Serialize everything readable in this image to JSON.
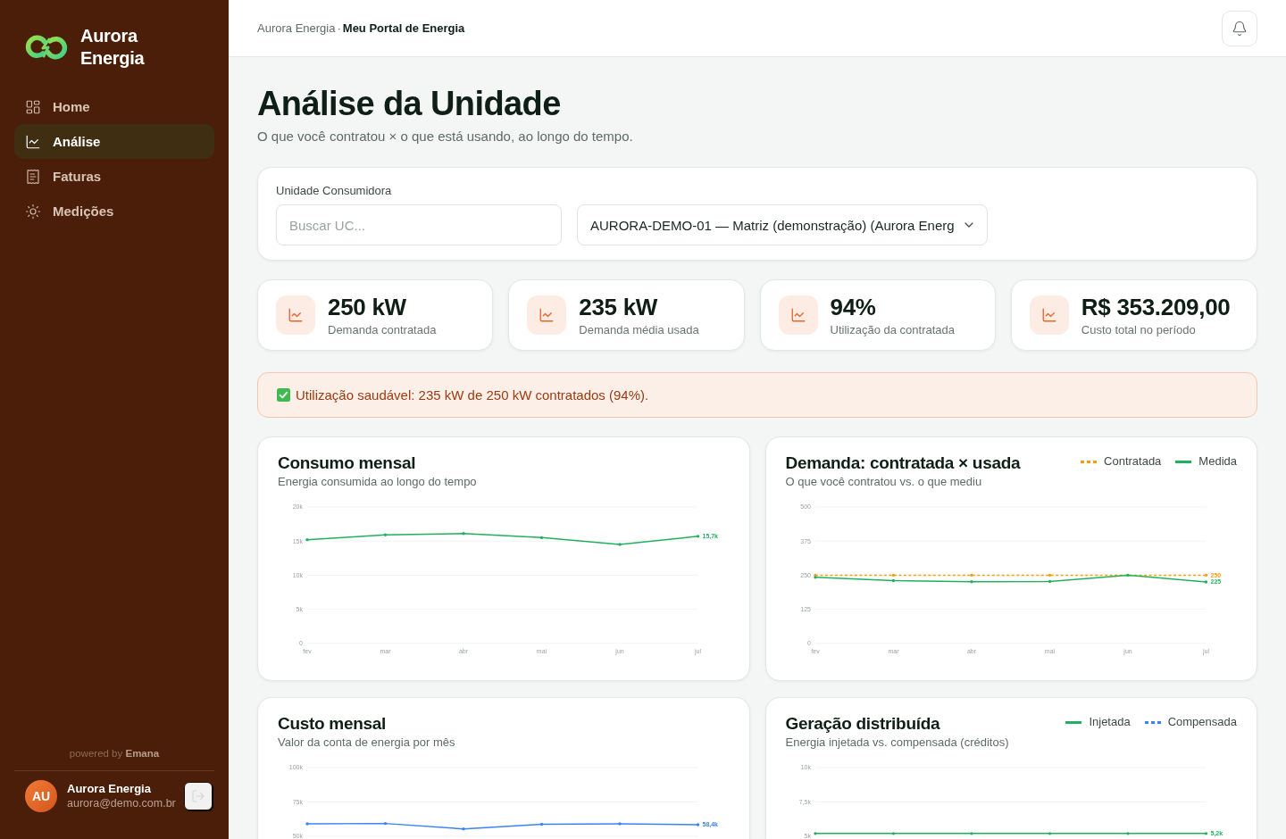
{
  "sidebar": {
    "brand": {
      "name": "Aurora Energia"
    },
    "nav": [
      {
        "label": "Home",
        "selected": false
      },
      {
        "label": "Análise",
        "selected": true
      },
      {
        "label": "Faturas",
        "selected": false
      },
      {
        "label": "Medições",
        "selected": false
      }
    ],
    "powered_by": "powered by **Emana**",
    "user": {
      "initials": "AU",
      "name": "Aurora Energia",
      "email": "aurora@demo.com.br"
    }
  },
  "header": {
    "breadcrumb": {
      "parent": "Aurora Energia",
      "separator": "·",
      "current": "Meu Portal de Energia"
    }
  },
  "page": {
    "title": "Análise da Unidade",
    "subtitle": "O que você contratou × o que está usando, ao longo do tempo."
  },
  "unit_selector": {
    "label": "Unidade Consumidora",
    "search": {
      "placeholder": "Buscar UC..."
    },
    "select": {
      "value": "AURORA-DEMO-01 — Matriz (demonstração) (Aurora Energ"
    }
  },
  "kpis": [
    {
      "value": "250 kW",
      "label": "Demanda contratada"
    },
    {
      "value": "235 kW",
      "label": "Demanda média usada"
    },
    {
      "value": "94%",
      "label": "Utilização da contratada"
    },
    {
      "value": "R$ 353.209,00",
      "label": "Custo total no período"
    }
  ],
  "alert": {
    "kind": "success",
    "text": "Utilização saudável: 235 kW de 250 kW contratados (94%)."
  },
  "charts": [
    {
      "title": "Consumo mensal",
      "subtitle": "Energia consumida ao longo do tempo",
      "chart_data": {
        "type": "line",
        "categories": [
          "fev",
          "mar",
          "abr",
          "mai",
          "jun",
          "jul"
        ],
        "series": [
          {
            "line_style": "solid",
            "color": "#21b15e",
            "values": [
              15200,
              15900,
              16100,
              15500,
              14500,
              15700
            ]
          }
        ],
        "ylim": [
          0,
          20000
        ],
        "yticks": [
          0,
          {
            "value": 5000,
            "label": "5k"
          },
          {
            "value": 10000,
            "label": "10k"
          },
          {
            "value": 15000,
            "label": "15k"
          },
          {
            "value": 20000,
            "label": "20k"
          }
        ],
        "grid": true,
        "annotations": [
          "15,7k"
        ]
      }
    },
    {
      "title": "Demanda: contratada × usada",
      "subtitle": "O que você contratou vs. o que mediu",
      "chart_data": {
        "type": "line",
        "categories": [
          "fev",
          "mar",
          "abr",
          "mai",
          "jun",
          "jul"
        ],
        "series": [
          {
            "name": "Contratada",
            "line_style": "dashed",
            "color": "#f59e0b",
            "values": [
              250,
              250,
              250,
              250,
              250,
              250
            ]
          },
          {
            "name": "Medida",
            "line_style": "solid",
            "color": "#21b15e",
            "values": [
              242,
              230,
              226,
              227,
              250,
              225
            ]
          }
        ],
        "ylim": [
          0,
          500
        ],
        "yticks": [
          0,
          125,
          250,
          375,
          500
        ],
        "grid": true,
        "annotations": [
          "250",
          "225"
        ]
      }
    },
    {
      "title": "Custo mensal",
      "subtitle": "Valor da conta de energia por mês",
      "chart_data": {
        "type": "line",
        "series": [
          {
            "line_style": "solid",
            "color": "#3b82f6",
            "values": [
              59000,
              59300,
              55300,
              58700,
              59000,
              58400
            ]
          }
        ],
        "ylim": [
          50000,
          100000
        ],
        "yticks": [
          {
            "value": 50000,
            "label": "50k"
          },
          {
            "value": 75000,
            "label": "75k"
          },
          {
            "value": 100000,
            "label": "100k"
          }
        ],
        "grid": true,
        "annotations": [
          "58,4k"
        ]
      }
    },
    {
      "title": "Geração distribuída",
      "subtitle": "Energia injetada vs. compensada (créditos)",
      "chart_data": {
        "type": "line",
        "series": [
          {
            "name": "Injetada",
            "line_style": "solid",
            "color": "#21b15e",
            "values": [
              5200,
              5200,
              5200,
              5200,
              5200,
              5200
            ]
          },
          {
            "name": "Compensada",
            "line_style": "dashed",
            "color": "#3b82f6"
          }
        ],
        "ylim": [
          5000,
          10000
        ],
        "yticks": [
          {
            "value": 5000,
            "label": "5k"
          },
          {
            "value": 7500,
            "label": "7,5k"
          },
          {
            "value": 10000,
            "label": "10k"
          }
        ],
        "grid": true,
        "annotations": [
          "5,2k"
        ]
      }
    }
  ]
}
